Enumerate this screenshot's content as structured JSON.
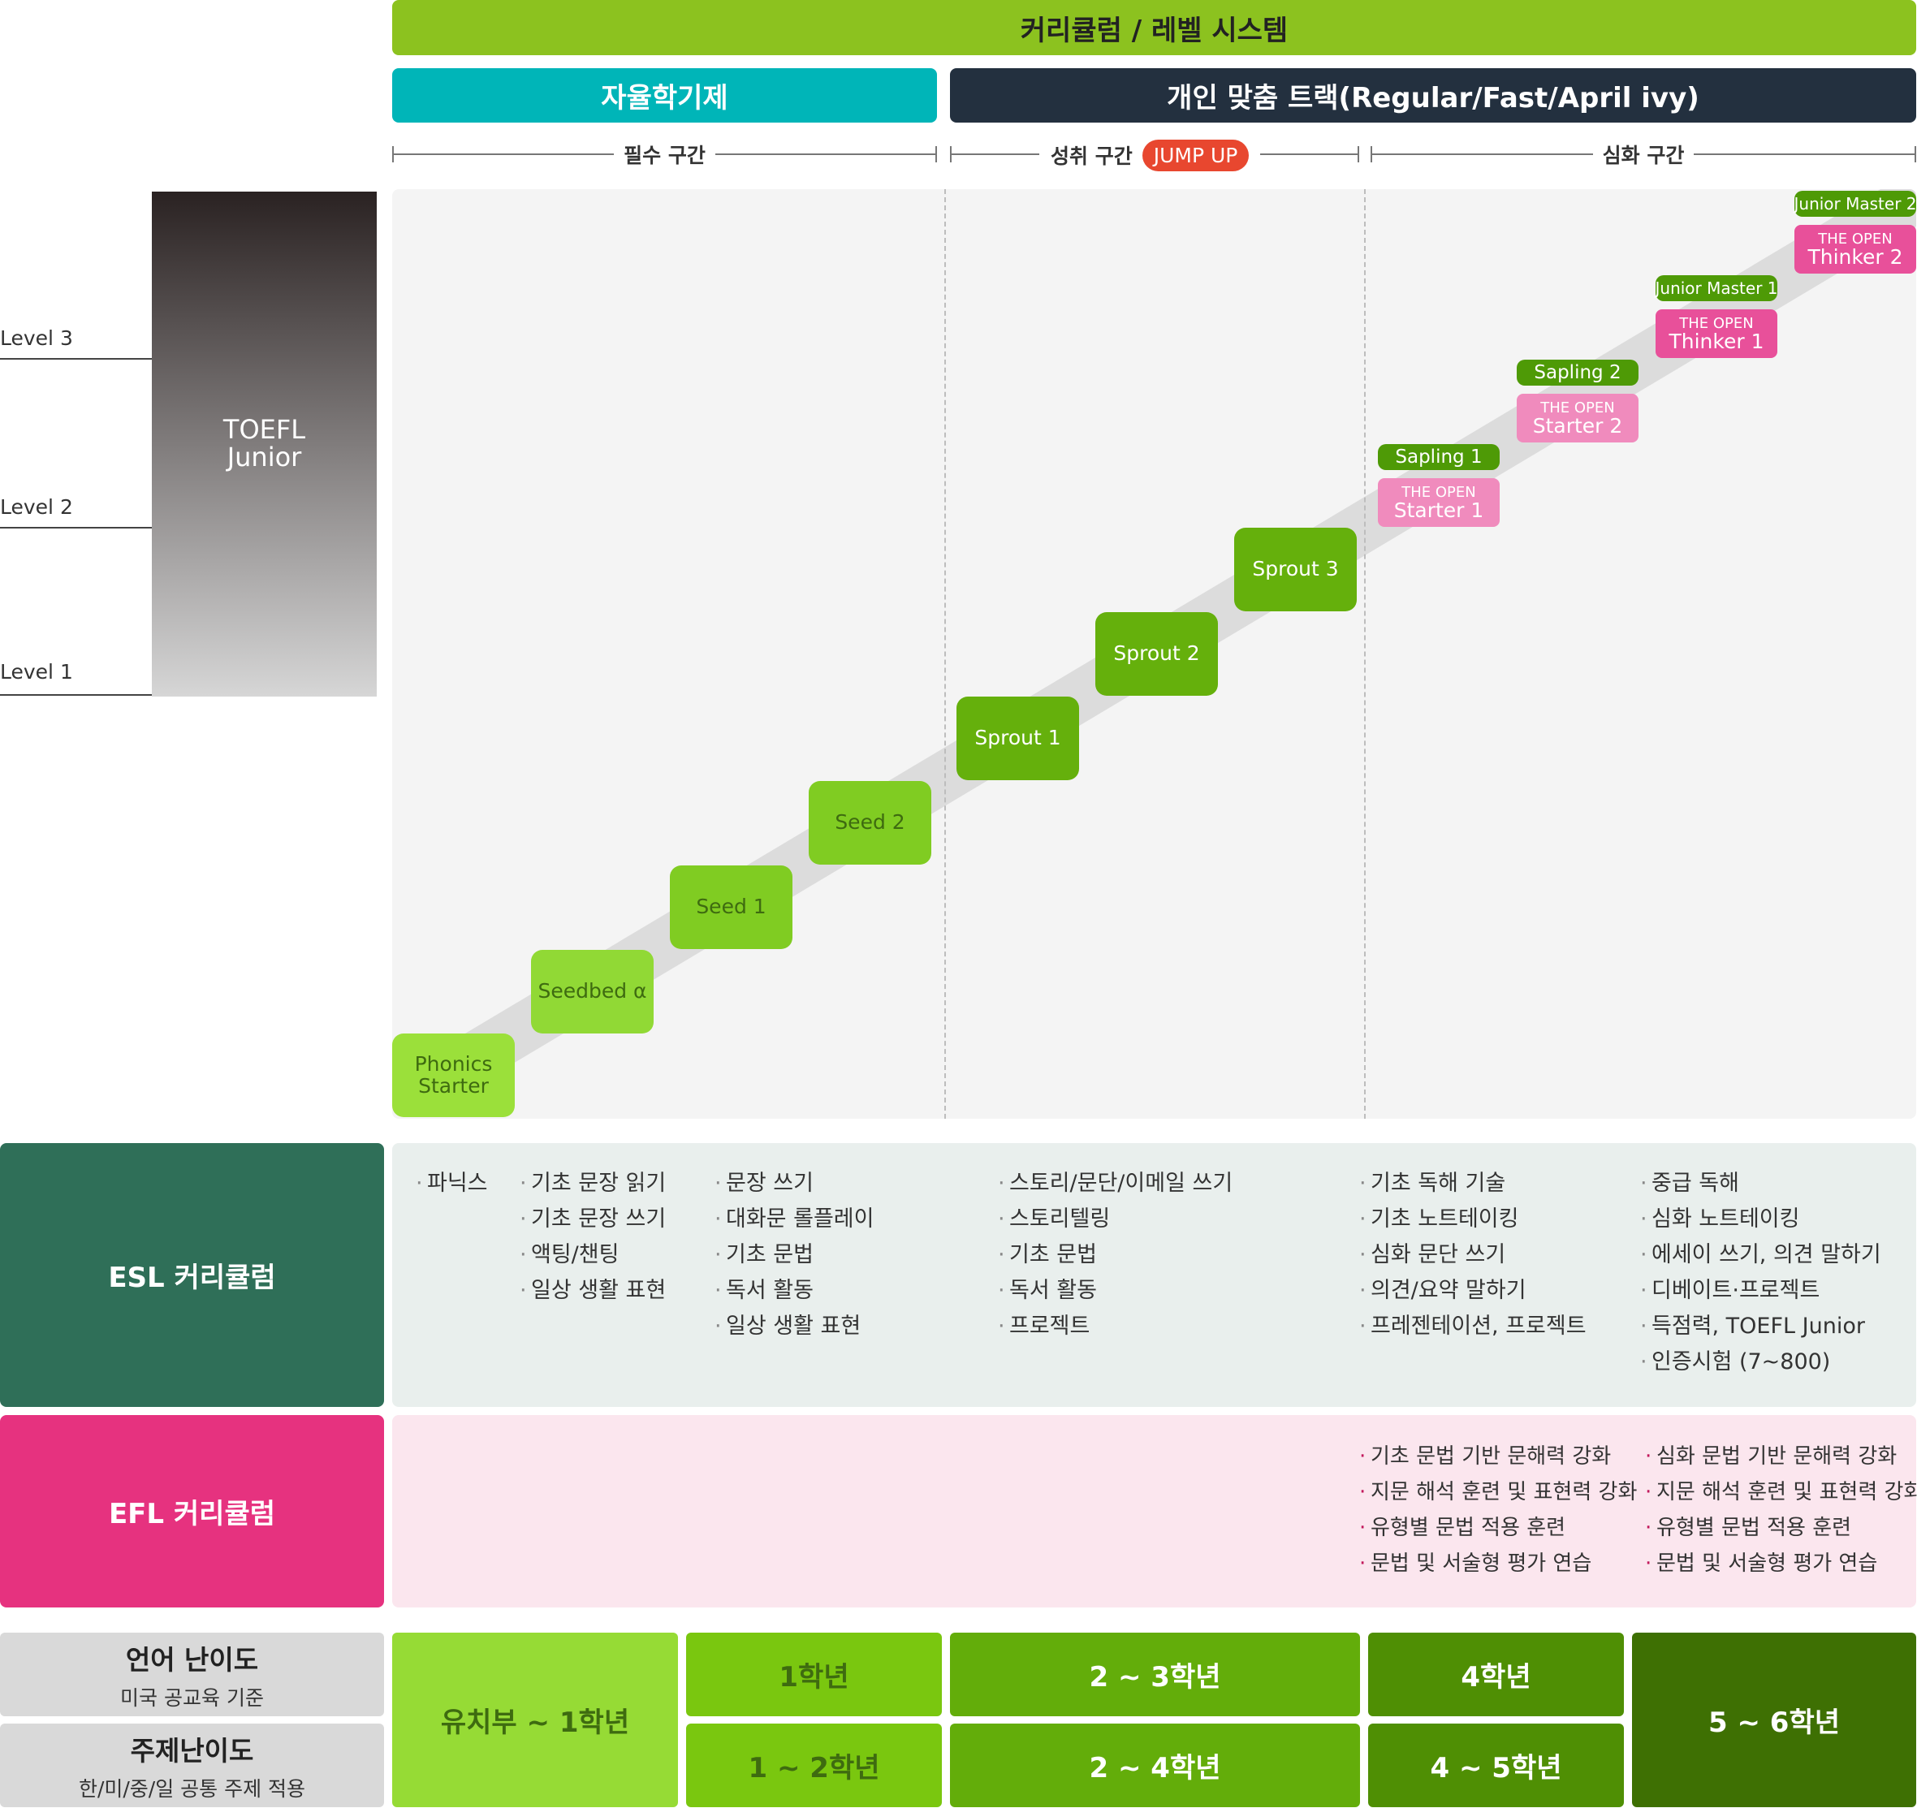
{
  "title": "커리큘럼 / 레벨 시스템",
  "tracks": {
    "left": "자율학기제",
    "right": "개인 맞춤 트랙(Regular/Fast/April ivy)"
  },
  "segments": {
    "required": "필수 구간",
    "achievement": "성취 구간",
    "jump_up": "JUMP UP",
    "advanced": "심화 구간"
  },
  "toefl": {
    "label_line1": "TOEFL",
    "label_line2": "Junior",
    "levels": [
      "Level 3",
      "Level 2",
      "Level 1"
    ]
  },
  "steps": [
    {
      "line1": "Phonics",
      "line2": "Starter"
    },
    {
      "line1": "Seedbed α",
      "line2": ""
    },
    {
      "line1": "Seed 1",
      "line2": ""
    },
    {
      "line1": "Seed 2",
      "line2": ""
    },
    {
      "line1": "Sprout 1",
      "line2": ""
    },
    {
      "line1": "Sprout 2",
      "line2": ""
    },
    {
      "line1": "Sprout 3",
      "line2": ""
    }
  ],
  "advanced_steps": [
    {
      "tag": "Sapling 1",
      "small": "THE OPEN",
      "big": "Starter 1"
    },
    {
      "tag": "Sapling 2",
      "small": "THE OPEN",
      "big": "Starter 2"
    },
    {
      "tag": "Junior Master 1",
      "small": "THE OPEN",
      "big": "Thinker 1"
    },
    {
      "tag": "Junior Master 2",
      "small": "THE OPEN",
      "big": "Thinker 2"
    }
  ],
  "esl": {
    "label": "ESL 커리큘럼",
    "columns": [
      [
        "파닉스"
      ],
      [
        "기초 문장 읽기",
        "기초 문장 쓰기",
        "액팅/챈팅",
        "일상 생활 표현"
      ],
      [
        "문장 쓰기",
        "대화문 롤플레이",
        "기초 문법",
        "독서 활동",
        "일상 생활 표현"
      ],
      [
        "스토리/문단/이메일 쓰기",
        "스토리텔링",
        "기초 문법",
        "독서 활동",
        "프로젝트"
      ],
      [
        "기초 독해 기술",
        "기초 노트테이킹",
        "심화 문단 쓰기",
        "의견/요약 말하기",
        "프레젠테이션, 프로젝트"
      ],
      [
        "중급 독해",
        "심화 노트테이킹",
        "에세이 쓰기, 의견 말하기",
        "디베이트·프로젝트",
        "득점력, TOEFL Junior",
        "인증시험 (7~800)"
      ]
    ]
  },
  "efl": {
    "label": "EFL 커리큘럼",
    "columns": [
      [
        "기초 문법 기반 문해력 강화",
        "지문 해석 훈련 및 표현력 강화",
        "유형별 문법 적용 훈련",
        "문법 및 서술형 평가 연습"
      ],
      [
        "심화 문법 기반 문해력 강화",
        "지문 해석 훈련 및 표현력 강화",
        "유형별 문법 적용 훈련",
        "문법 및 서술형 평가 연습"
      ]
    ]
  },
  "difficulty": {
    "language_title": "언어 난이도",
    "language_sub": "미국 공교육 기준",
    "topic_title": "주제난이도",
    "topic_sub": "한/미/중/일 공통 주제 적용",
    "kinder": "유치부 ~ 1학년",
    "lang_1": "1학년",
    "topic_1": "1 ~ 2학년",
    "lang_2": "2 ~ 3학년",
    "topic_2": "2 ~ 4학년",
    "lang_3": "4학년",
    "topic_3": "4 ~ 5학년",
    "final": "5 ~ 6학년"
  },
  "colors": {
    "title_green": "#8cc21f",
    "teal": "#00b5b8",
    "navy": "#23303f",
    "jump_red": "#e8472f",
    "esl_green": "#2f6f58",
    "efl_pink": "#e6327f",
    "open_pink_light": "#f08bbd",
    "open_pink": "#e8509a"
  }
}
